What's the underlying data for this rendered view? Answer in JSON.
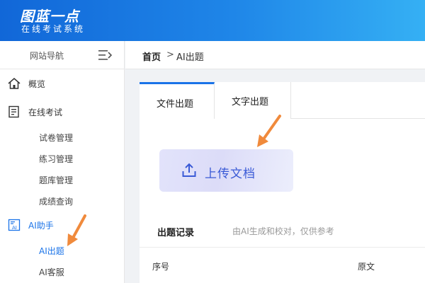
{
  "header": {
    "logo_main": "图蓝一点",
    "logo_sub": "在线考试系统"
  },
  "sidebar": {
    "title": "网站导航",
    "items": [
      {
        "label": "概览",
        "icon": "home-icon"
      },
      {
        "label": "在线考试",
        "icon": "exam-list-icon"
      },
      {
        "label": "试卷管理"
      },
      {
        "label": "练习管理"
      },
      {
        "label": "题库管理"
      },
      {
        "label": "成绩查询"
      },
      {
        "label": "AI助手",
        "icon": "ai-icon"
      },
      {
        "label": "AI出题",
        "active": true
      },
      {
        "label": "AI客服"
      }
    ]
  },
  "breadcrumb": {
    "home": "首页",
    "separator": ">",
    "current": "AI出题"
  },
  "tabs": [
    {
      "label": "文件出题",
      "active": true
    },
    {
      "label": "文字出题"
    }
  ],
  "upload": {
    "label": "上传文档",
    "icon": "upload-icon"
  },
  "records": {
    "title": "出题记录",
    "hint": "由AI生成和校对，仅供参考"
  },
  "table": {
    "columns": [
      "序号",
      "原文"
    ]
  },
  "colors": {
    "accent": "#1a73e8",
    "arrow": "#f08a3c",
    "header_start": "#1167d8",
    "header_end": "#35b0f4"
  }
}
